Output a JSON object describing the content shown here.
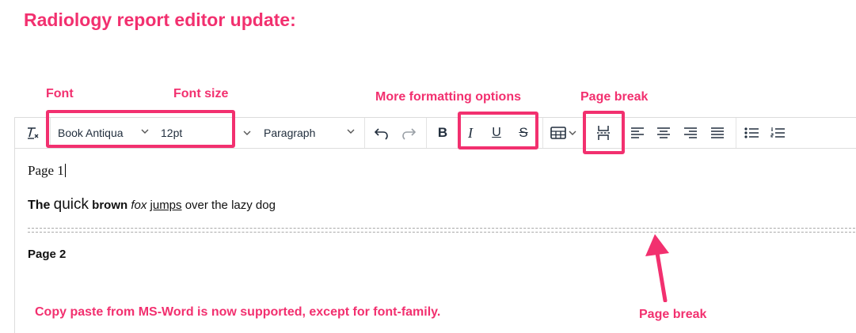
{
  "annotations": {
    "title": "Radiology report editor update:",
    "font": "Font",
    "font_size": "Font size",
    "more_formatting": "More formatting options",
    "page_break_top": "Page break",
    "copy_paste": "Copy paste from MS-Word is now supported, except for font-family.",
    "page_break_bottom": "Page break"
  },
  "toolbar": {
    "font_family": "Book Antiqua",
    "font_size": "12pt",
    "block_format": "Paragraph",
    "bold_label": "B",
    "italic_label": "I",
    "underline_label": "U",
    "strikethrough_label": "S",
    "icons": [
      "clear-formatting-icon",
      "chevron-down-icon",
      "undo-icon",
      "redo-icon",
      "table-icon",
      "page-break-icon",
      "align-left-icon",
      "align-center-icon",
      "align-right-icon",
      "align-justify-icon",
      "bullet-list-icon",
      "numbered-list-icon"
    ]
  },
  "editor": {
    "page1_label": "Page 1",
    "sample": {
      "the": "The",
      "quick": "quick",
      "brown": "brown",
      "fox": "fox",
      "jumps": "jumps",
      "rest": "over the lazy dog"
    },
    "page2_label": "Page 2"
  },
  "colors": {
    "accent": "#f2306f",
    "icon": "#222f3e",
    "separator": "#e3e3e3"
  }
}
